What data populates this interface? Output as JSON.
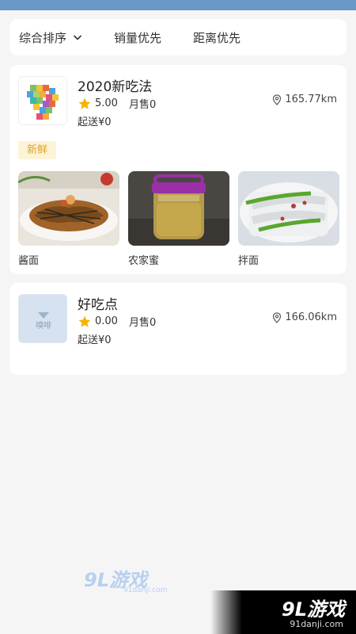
{
  "sort_bar": {
    "comprehensive": "综合排序",
    "sales_first": "销量优先",
    "distance_first": "距离优先"
  },
  "shops": [
    {
      "name": "2020新吃法",
      "rating": "5.00",
      "monthly_sales": "月售0",
      "min_order": "起送¥0",
      "distance": "165.77km",
      "tag": "新鲜",
      "dishes": [
        {
          "label": "酱面"
        },
        {
          "label": "农家蜜"
        },
        {
          "label": "拌面"
        }
      ]
    },
    {
      "name": "好吃点",
      "rating": "0.00",
      "monthly_sales": "月售0",
      "min_order": "起送¥0",
      "distance": "166.06km",
      "logo_text": "嗅啡"
    }
  ],
  "watermark": {
    "center_logo": "9L游戏",
    "center_url": "91danji.com",
    "corner_logo": "9L游戏",
    "corner_url": "91danji.com"
  },
  "colors": {
    "top_bar": "#6a98c8",
    "star": "#f5b300",
    "tag_bg": "#fdf3d6",
    "tag_text": "#e0a325"
  }
}
